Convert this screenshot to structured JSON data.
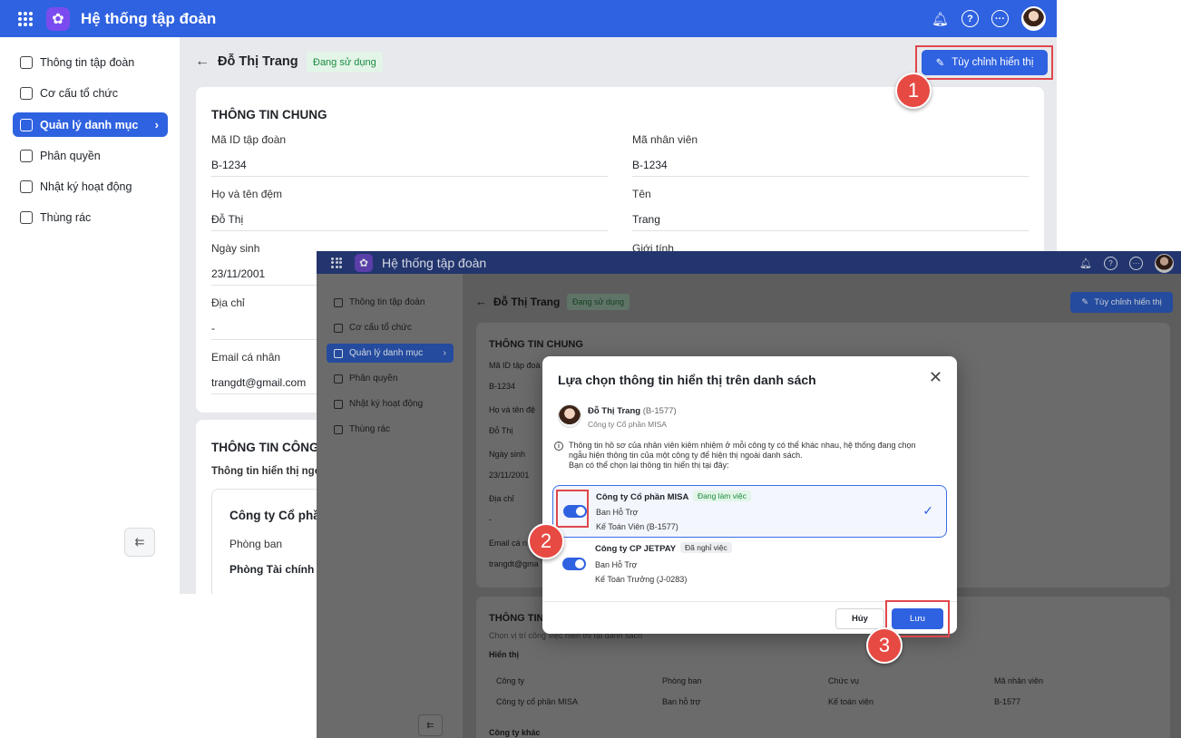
{
  "app": {
    "title": "Hệ thống tập đoàn"
  },
  "sidebar": {
    "items": [
      {
        "label": "Thông tin tập đoàn",
        "icon": "home-icon"
      },
      {
        "label": "Cơ cấu tổ chức",
        "icon": "org-chart-icon"
      },
      {
        "label": "Quản lý danh mục",
        "icon": "catalog-icon",
        "active": true
      },
      {
        "label": "Phân quyền",
        "icon": "permission-icon"
      },
      {
        "label": "Nhật ký hoạt động",
        "icon": "history-icon"
      },
      {
        "label": "Thùng rác",
        "icon": "trash-icon"
      }
    ]
  },
  "header": {
    "employee_name": "Đỗ Thị Trang",
    "status": "Đang sử dụng",
    "customize_label": "Tùy chỉnh hiển thị"
  },
  "general": {
    "title": "THÔNG TIN CHUNG",
    "fields": [
      {
        "label": "Mã ID tập đoàn",
        "value": "B-1234"
      },
      {
        "label": "Mã nhân viên",
        "value": "B-1234"
      },
      {
        "label": "Họ và tên đệm",
        "value": "Đỗ Thị"
      },
      {
        "label": "Tên",
        "value": "Trang"
      },
      {
        "label": "Ngày sinh",
        "value": "23/11/2001"
      },
      {
        "label": "Giới tính",
        "value": ""
      },
      {
        "label": "Địa chỉ",
        "value": "-"
      },
      {
        "label": "Email cá nhân",
        "value": "trangdt@gmail.com"
      }
    ]
  },
  "work": {
    "title": "THÔNG TIN CÔNG",
    "subtitle": "Thông tin hiển thị ngo",
    "company": "Công ty Cổ phầ",
    "dept_label": "Phòng ban",
    "dept_value": "Phòng Tài chính -"
  },
  "overlay": {
    "title": "Hệ thống tập đoàn",
    "general_labels": [
      "Mã ID tập đoà",
      "Họ và tên đệ",
      "Ngày sinh",
      "Địa chỉ",
      "Email cá n"
    ],
    "general_values": [
      "B-1234",
      "Đỗ Thị",
      "23/11/2001",
      "-",
      "trangdt@gma"
    ],
    "work_title": "THÔNG TIN",
    "work_subtitle": "Chọn vị trí công việc hiển thị tại danh sách",
    "show_label": "Hiển thị",
    "table_headers": [
      "Công ty",
      "Phòng ban",
      "Chức vụ",
      "Mã nhân viên"
    ],
    "table_values": [
      "Công ty cổ phần MISA",
      "Ban hỗ trợ",
      "Kế toán viên",
      "B-1577"
    ],
    "other_company": "Công ty khác"
  },
  "modal": {
    "title": "Lựa chọn thông tin hiển thị trên danh sách",
    "employee_name": "Đỗ Thị Trang",
    "employee_code": "(B-1577)",
    "company": "Công ty Cổ phần MISA",
    "info_line1": "Thông tin hồ sơ của nhân viên kiêm nhiệm ở mỗi công ty có thể khác nhau, hệ thống đang chọn",
    "info_line2": "ngẫu hiện thông tin của một công ty để hiện thị ngoài danh sách.",
    "info_line3": "Bạn có thể chọn lại thông tin hiển thị tại đây:",
    "options": [
      {
        "company": "Công ty Cổ phần MISA",
        "status": "Đang làm việc",
        "dept": "Ban Hỗ Trợ",
        "position": "Kế Toán Viên (B-1577)",
        "enabled": true,
        "selected": true
      },
      {
        "company": "Công ty CP JETPAY",
        "status": "Đã nghỉ việc",
        "dept": "Ban Hỗ Trợ",
        "position": "Kế Toán Trưởng (J-0283)",
        "enabled": true,
        "selected": false
      }
    ],
    "cancel_label": "Hủy",
    "save_label": "Lưu"
  },
  "steps": [
    "1",
    "2",
    "3"
  ],
  "colors": {
    "primary": "#2f62e0",
    "step": "#e64a43",
    "highlight": "#e0474c",
    "success": "#1c8a3f"
  }
}
